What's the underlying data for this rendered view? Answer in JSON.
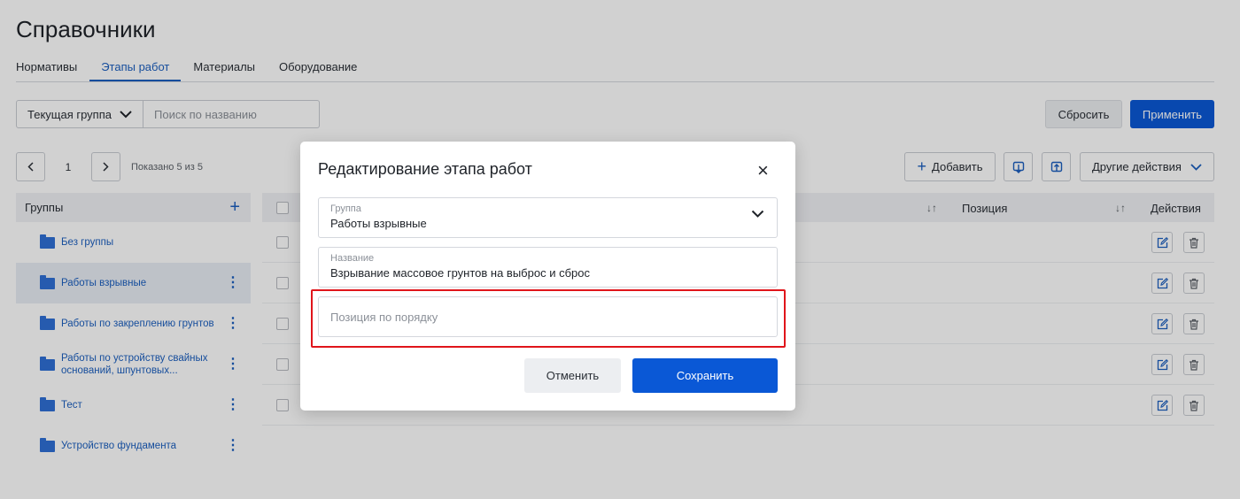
{
  "page": {
    "title": "Справочники"
  },
  "tabs": [
    {
      "label": "Нормативы",
      "active": false
    },
    {
      "label": "Этапы работ",
      "active": true
    },
    {
      "label": "Материалы",
      "active": false
    },
    {
      "label": "Оборудование",
      "active": false
    }
  ],
  "filters": {
    "group_select": "Текущая группа",
    "search_placeholder": "Поиск по названию",
    "reset_label": "Сбросить",
    "apply_label": "Применить"
  },
  "pagination": {
    "current_page": "1",
    "info": "Показано 5 из 5"
  },
  "toolbar": {
    "add_label": "Добавить",
    "more_label": "Другие действия"
  },
  "groups": {
    "header": "Группы",
    "items": [
      {
        "label": "Без группы"
      },
      {
        "label": "Работы взрывные"
      },
      {
        "label": "Работы по закреплению грунтов"
      },
      {
        "label": "Работы по устройству свайных оснований, шпунтовых..."
      },
      {
        "label": "Тест"
      },
      {
        "label": "Устройство фундамента"
      }
    ]
  },
  "table": {
    "columns": {
      "position": "Позиция",
      "actions": "Действия"
    },
    "row_count": 5
  },
  "modal": {
    "title": "Редактирование этапа работ",
    "group_field": {
      "label": "Группа",
      "value": "Работы взрывные"
    },
    "name_field": {
      "label": "Название",
      "value": "Взрывание массовое грунтов на выброс и сброс"
    },
    "position_field": {
      "placeholder": "Позиция по порядку"
    },
    "cancel_label": "Отменить",
    "save_label": "Сохранить"
  },
  "colors": {
    "accent": "#0a58d6",
    "highlight": "#e0151b"
  }
}
